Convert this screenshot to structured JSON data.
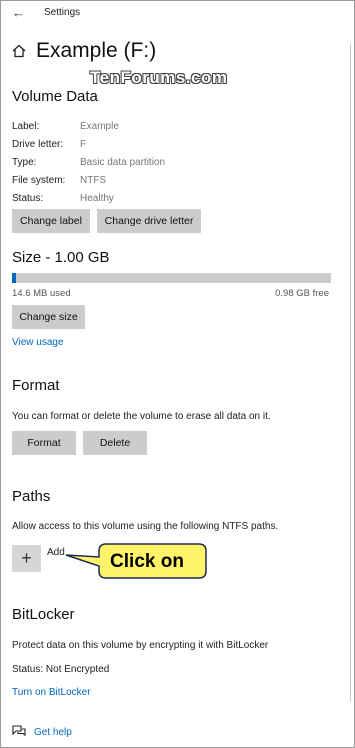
{
  "window": {
    "title": "Settings",
    "back_icon": "back-arrow-icon"
  },
  "header": {
    "title": "Example (F:)",
    "watermark": "TenForums.com"
  },
  "volume_data": {
    "heading": "Volume Data",
    "rows": [
      {
        "label": "Label:",
        "value": "Example"
      },
      {
        "label": "Drive letter:",
        "value": "F"
      },
      {
        "label": "Type:",
        "value": "Basic data partition"
      },
      {
        "label": "File system:",
        "value": "NTFS"
      },
      {
        "label": "Status:",
        "value": "Healthy"
      }
    ],
    "change_label_button": "Change label",
    "change_letter_button": "Change drive letter"
  },
  "size": {
    "heading": "Size - 1.00 GB",
    "used": "14.6 MB used",
    "free": "0.98 GB free",
    "used_fraction": 0.014,
    "change_size_button": "Change size",
    "view_usage_link": "View usage"
  },
  "format": {
    "heading": "Format",
    "description": "You can format or delete the volume to erase all data on it.",
    "format_button": "Format",
    "delete_button": "Delete"
  },
  "paths": {
    "heading": "Paths",
    "description": "Allow access to this volume using the following NTFS paths.",
    "add_label": "Add",
    "callout": "Click on"
  },
  "bitlocker": {
    "heading": "BitLocker",
    "description": "Protect data on this volume by encrypting it with BitLocker",
    "status": "Status: Not Encrypted",
    "turn_on_link": "Turn on BitLocker"
  },
  "footer": {
    "get_help_link": "Get help"
  },
  "colors": {
    "accent": "#0067c0",
    "button_bg": "#cccccc",
    "callout_fill": "#fff36a",
    "callout_border": "#1f2a57"
  }
}
